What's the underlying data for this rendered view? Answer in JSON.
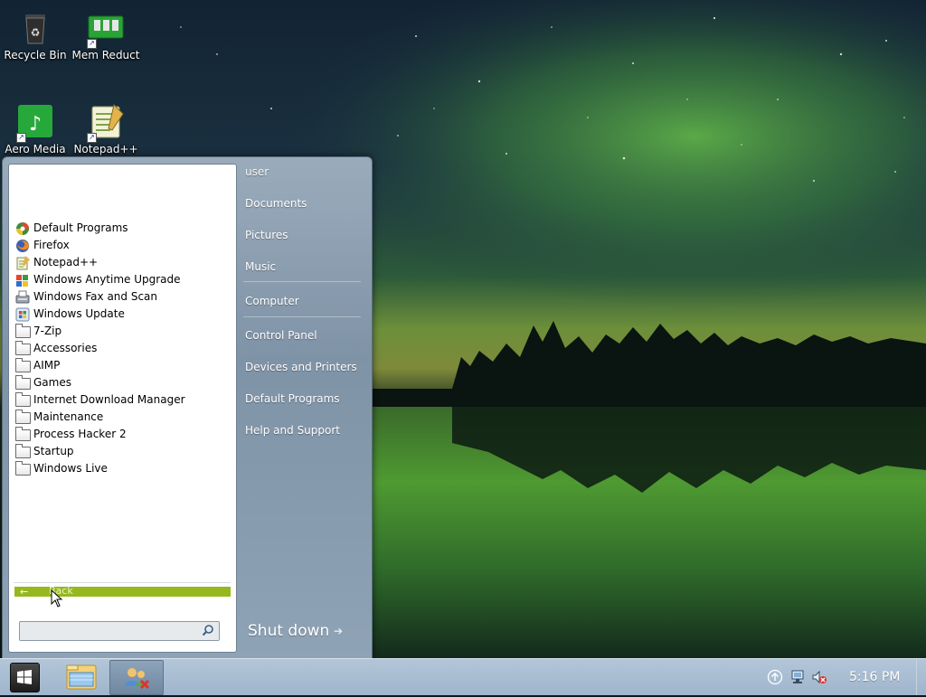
{
  "desktop": {
    "icons": [
      {
        "label": "Recycle Bin",
        "icon": "recycle-bin-icon"
      },
      {
        "label": "Mem Reduct",
        "icon": "memory-chip-icon"
      },
      {
        "label": "Aero Media",
        "icon": "music-note-icon"
      },
      {
        "label": "Notepad++",
        "icon": "notepad-icon"
      }
    ]
  },
  "start_menu": {
    "programs": [
      {
        "label": "Default Programs",
        "icon": "default-programs-icon"
      },
      {
        "label": "Firefox",
        "icon": "firefox-icon"
      },
      {
        "label": "Notepad++",
        "icon": "notepad-icon"
      },
      {
        "label": "Windows Anytime Upgrade",
        "icon": "windows-flag-icon"
      },
      {
        "label": "Windows Fax and Scan",
        "icon": "fax-icon"
      },
      {
        "label": "Windows Update",
        "icon": "windows-update-icon"
      },
      {
        "label": "7-Zip",
        "icon": "folder-icon"
      },
      {
        "label": "Accessories",
        "icon": "folder-icon"
      },
      {
        "label": "AIMP",
        "icon": "folder-icon"
      },
      {
        "label": "Games",
        "icon": "folder-icon"
      },
      {
        "label": "Internet Download Manager",
        "icon": "folder-icon"
      },
      {
        "label": "Maintenance",
        "icon": "folder-icon"
      },
      {
        "label": "Process Hacker 2",
        "icon": "folder-icon"
      },
      {
        "label": "Startup",
        "icon": "folder-icon"
      },
      {
        "label": "Windows Live",
        "icon": "folder-icon"
      }
    ],
    "back_label": "Back",
    "search": {
      "placeholder": "",
      "value": ""
    },
    "places": [
      {
        "label": "user"
      },
      {
        "label": "Documents"
      },
      {
        "label": "Pictures"
      },
      {
        "label": "Music"
      },
      {
        "label": "Computer"
      },
      {
        "label": "Control Panel"
      },
      {
        "label": "Devices and Printers"
      },
      {
        "label": "Default Programs"
      },
      {
        "label": "Help and Support"
      }
    ],
    "shutdown_label": "Shut down",
    "colors": {
      "back_highlight": "#96b81e"
    }
  },
  "taskbar": {
    "buttons": [
      {
        "name": "start",
        "icon": "windows-logo-icon"
      },
      {
        "name": "explorer",
        "icon": "folder-explorer-icon"
      },
      {
        "name": "network",
        "icon": "network-people-icon"
      }
    ],
    "tray": [
      {
        "icon": "arrow-up-circle-icon"
      },
      {
        "icon": "network-monitor-icon"
      },
      {
        "icon": "speaker-muted-icon"
      }
    ],
    "clock": "5:16 PM"
  }
}
